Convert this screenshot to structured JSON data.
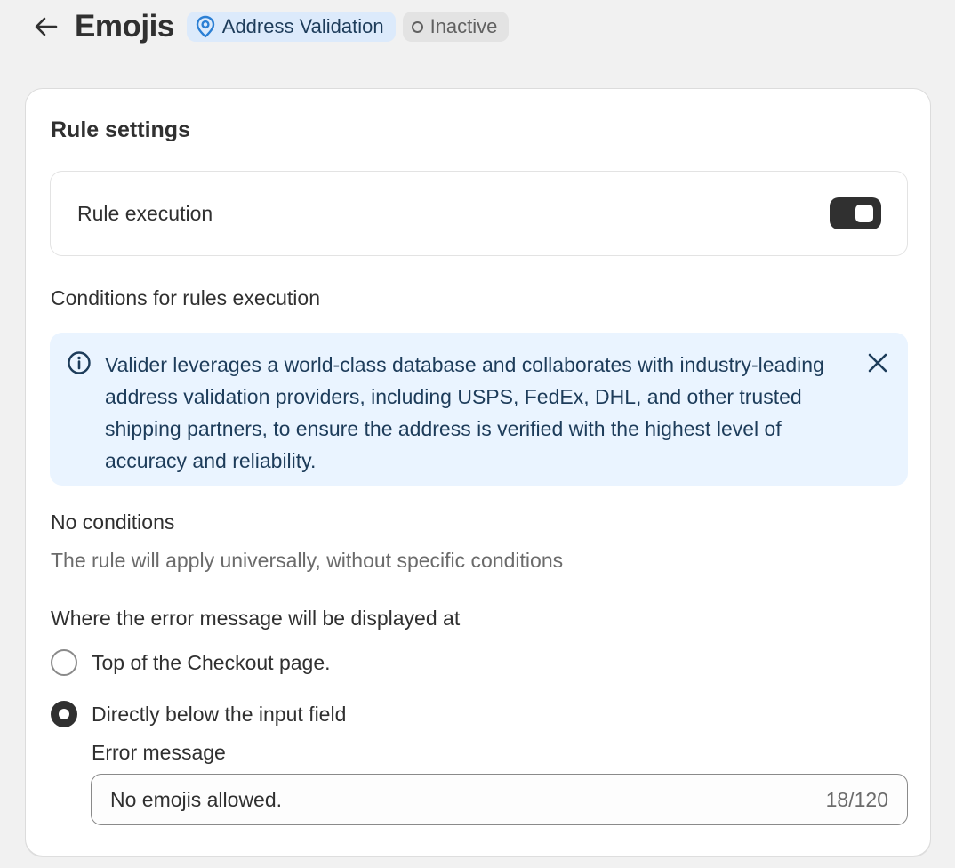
{
  "header": {
    "title": "Emojis",
    "badge_info_label": "Address Validation",
    "badge_status_label": "Inactive"
  },
  "card": {
    "title": "Rule settings",
    "rule_execution_label": "Rule execution",
    "rule_execution_enabled": true,
    "conditions_heading": "Conditions for rules execution",
    "banner_text": "Valider leverages a world-class database and collaborates with industry-leading address validation providers, including USPS, FedEx, DHL, and other trusted shipping partners, to ensure the address is verified with the highest level of accuracy and reliability.",
    "no_conditions_title": "No conditions",
    "no_conditions_desc": "The rule will apply universally, without specific conditions",
    "display_heading": "Where the error message will be displayed at",
    "radio_options": [
      {
        "label": "Top of the Checkout page.",
        "checked": false
      },
      {
        "label": "Directly below the input field",
        "checked": true
      }
    ],
    "error_message_label": "Error message",
    "error_message_value": "No emojis allowed.",
    "error_message_count": "18/120"
  },
  "colors": {
    "info_badge_bg": "#dceafb",
    "banner_bg": "#eaf4ff",
    "toggle_on": "#303030"
  }
}
